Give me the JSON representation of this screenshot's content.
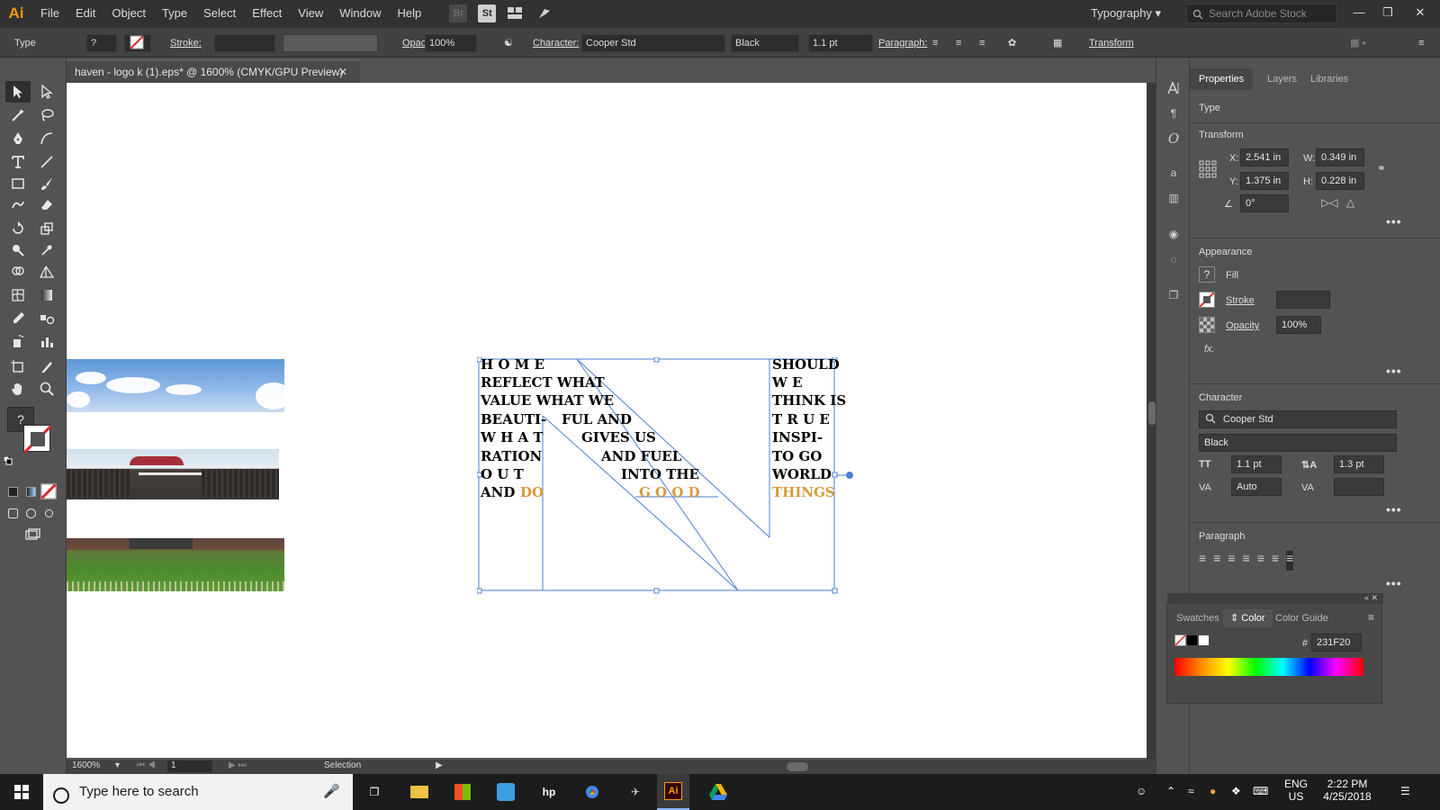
{
  "app": {
    "logo": "Ai",
    "menu": [
      "File",
      "Edit",
      "Object",
      "Type",
      "Select",
      "Effect",
      "View",
      "Window",
      "Help"
    ],
    "menu_icons": [
      "Br",
      "St"
    ],
    "workspace": "Typography",
    "search_placeholder": "Search Adobe Stock"
  },
  "control_bar": {
    "type_label": "Type",
    "stroke_label": "Stroke:",
    "opacity_label": "Opacity:",
    "opacity_value": "100%",
    "character_label": "Character:",
    "font_family": "Cooper Std",
    "font_style": "Black",
    "font_size": "1.1 pt",
    "paragraph_label": "Paragraph:",
    "transform_label": "Transform"
  },
  "document": {
    "tab_title": "haven - logo k (1).eps* @ 1600% (CMYK/GPU Preview)",
    "zoom": "1600%",
    "page": "1",
    "status": "Selection"
  },
  "logo_text": {
    "l1": "H  O  M  E",
    "l2": "REFLECT WHAT",
    "l3": "VALUE  WHAT  WE",
    "l4a": "BEAUTI-",
    "l4b": "FUL  AND",
    "l5a": "W H A T",
    "l5b": "GIVES  US",
    "l6a": "RATION",
    "l6b": "AND FUEL",
    "l7a": "O  U  T",
    "l7b": "INTO  THE",
    "l8a": "AND",
    "l8b": "DO",
    "l8c": "G  O  O  D",
    "r1": "SHOULD",
    "r2": "W         E",
    "r3": "THINK IS",
    "r4": "T R U E",
    "r5": "INSPI-",
    "r6": "TO   GO",
    "r7": "WORLD",
    "r8": "THINGS"
  },
  "properties": {
    "tabs": [
      "Properties",
      "Layers",
      "Libraries"
    ],
    "selection_type": "Type",
    "transform_title": "Transform",
    "x_label": "X:",
    "x_value": "2.541 in",
    "y_label": "Y:",
    "y_value": "1.375 in",
    "w_label": "W:",
    "w_value": "0.349 in",
    "h_label": "H:",
    "h_value": "0.228 in",
    "angle_value": "0°",
    "appearance_title": "Appearance",
    "fill_label": "Fill",
    "stroke_label": "Stroke",
    "opacity_label": "Opacity",
    "opacity_value": "100%",
    "fx_label": "fx.",
    "character_title": "Character",
    "font_family": "Cooper Std",
    "font_style": "Black",
    "font_size": "1.1 pt",
    "leading": "1.3 pt",
    "kerning": "Auto",
    "paragraph_title": "Paragraph"
  },
  "color_panel": {
    "tabs": [
      "Swatches",
      "Color",
      "Color Guide"
    ],
    "hex_label": "#",
    "hex_value": "231F20"
  },
  "taskbar": {
    "search_placeholder": "Type here to search",
    "lang": "ENG",
    "region": "US",
    "time": "2:22 PM",
    "date": "4/25/2018"
  },
  "colors": {
    "accent_gold": "#d99a3c",
    "selection_blue": "#4a7fd4",
    "ui_dark": "#323232"
  }
}
